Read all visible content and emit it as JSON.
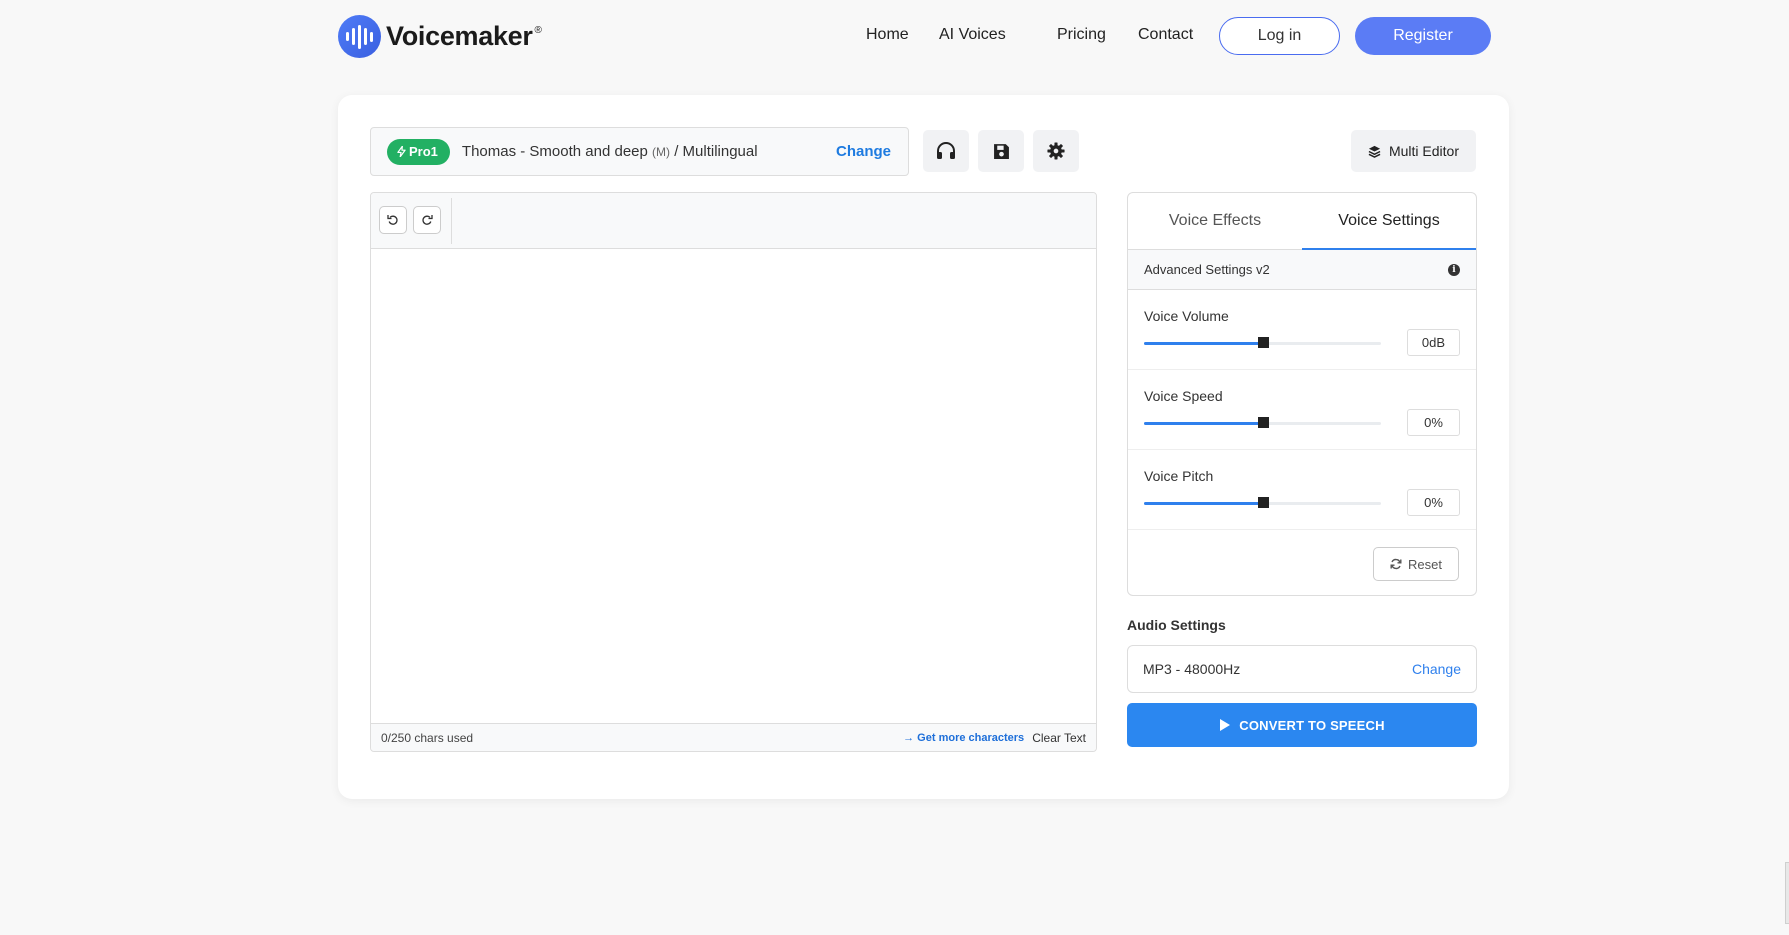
{
  "header": {
    "brand": "Voicemaker",
    "brand_mark": "®",
    "nav": [
      "Home",
      "AI Voices",
      "Pricing",
      "Contact"
    ],
    "login_label": "Log in",
    "register_label": "Register"
  },
  "voice_selector": {
    "badge": "Pro1",
    "voice_name": "Thomas - Smooth and deep",
    "gender_tag": "(M)",
    "language": "/ Multilingual",
    "change_label": "Change"
  },
  "toolbar": {
    "multi_editor_label": "Multi Editor"
  },
  "editor": {
    "chars_used": "0/250 chars used",
    "more_chars": "→ Get more characters",
    "clear_text": "Clear Text"
  },
  "settings_panel": {
    "tabs": [
      "Voice Effects",
      "Voice Settings"
    ],
    "active_tab": "Voice Settings",
    "advanced_label": "Advanced Settings v2",
    "settings": [
      {
        "label": "Voice Volume",
        "value": "0dB",
        "level": 0.5
      },
      {
        "label": "Voice Speed",
        "value": "0%",
        "level": 0.5
      },
      {
        "label": "Voice Pitch",
        "value": "0%",
        "level": 0.5
      }
    ],
    "reset_label": "Reset"
  },
  "audio": {
    "label": "Audio Settings",
    "format": "MP3 - 48000Hz",
    "change_label": "Change"
  },
  "convert_label": "CONVERT TO SPEECH",
  "colors": {
    "accent": "#2b87f0",
    "brand": "#5b7cf5",
    "badge_green": "#22b063"
  }
}
